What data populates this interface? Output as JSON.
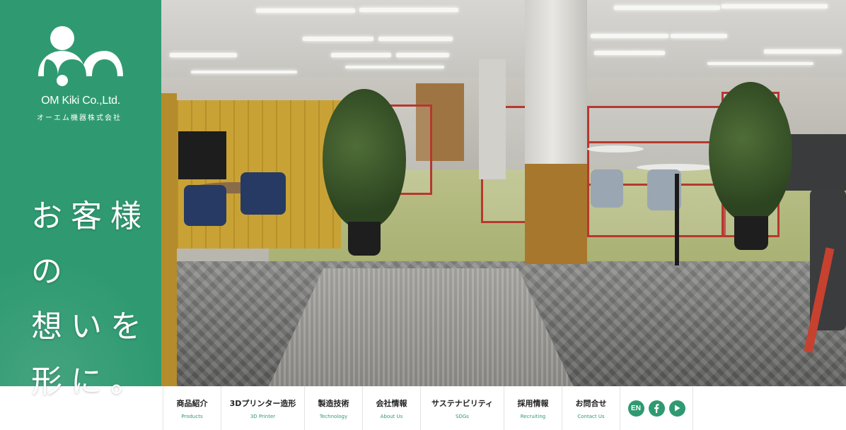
{
  "brand": {
    "name": "OM Kiki Co.,Ltd.",
    "name_jp": "オーエム機器株式会社",
    "color": "#2f9a71"
  },
  "hero": {
    "catch_line1": "お客様の",
    "catch_line2": "想いを形に。",
    "photo": "office-interior-photo"
  },
  "nav": {
    "items": [
      {
        "jp": "商品紹介",
        "en": "Products"
      },
      {
        "jp": "3Dプリンター造形",
        "en": "3D Printer"
      },
      {
        "jp": "製造技術",
        "en": "Technology"
      },
      {
        "jp": "会社情報",
        "en": "About Us"
      },
      {
        "jp": "サステナビリティ",
        "en": "SDGs"
      },
      {
        "jp": "採用情報",
        "en": "Recruiting"
      },
      {
        "jp": "お問合せ",
        "en": "Contact Us"
      }
    ],
    "icons": {
      "lang_label": "EN",
      "facebook_icon": "facebook-icon",
      "youtube_icon": "play-icon"
    }
  }
}
